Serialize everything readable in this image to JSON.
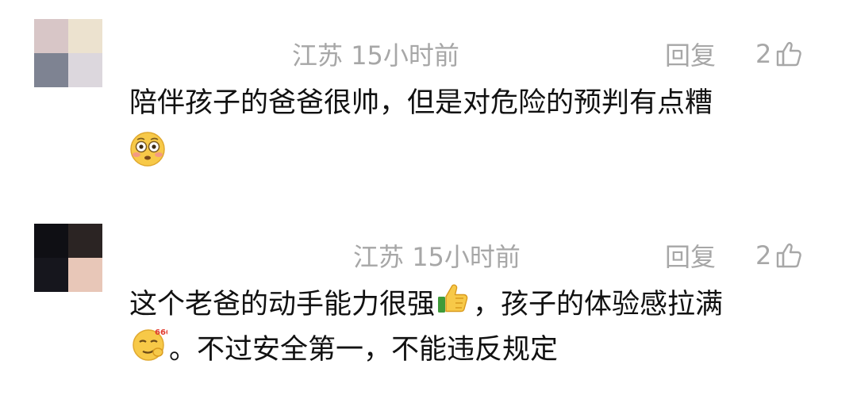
{
  "comments": [
    {
      "avatar_colors": [
        "#d8c6c7",
        "#ece2cf",
        "#7e8392",
        "#dcd7dd"
      ],
      "location": "江苏",
      "time": "15小时前",
      "reply_label": "回复",
      "like_count": "2",
      "text_line1": "陪伴孩子的爸爸很帅，但是对危险的预判有点糟",
      "emojis": [
        "flushed-face-emoji"
      ]
    },
    {
      "avatar_colors": [
        "#0f0f14",
        "#2b2423",
        "#16161d",
        "#e8c7b8"
      ],
      "location": "江苏",
      "time": "15小时前",
      "reply_label": "回复",
      "like_count": "2",
      "text_line1_a": "这个老爸的动手能力很强",
      "text_line1_b": "，孩子的体验感拉满",
      "text_line2": "。不过安全第一，不能违反规定",
      "emojis": [
        "thumbs-up-emoji",
        "smirk-666-emoji"
      ]
    }
  ],
  "colors": {
    "meta": "#a7a7a7",
    "text": "#111111",
    "background": "#ffffff"
  }
}
